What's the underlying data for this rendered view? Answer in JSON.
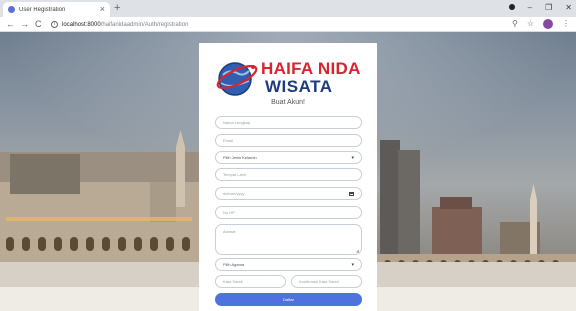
{
  "browser": {
    "tab_title": "User Registration",
    "tab_close": "×",
    "new_tab": "+",
    "url_host": "localhost:8000",
    "url_path": "/haifanidaadmin/Auth/registration",
    "back": "←",
    "forward": "→",
    "reload": "C",
    "info": "i",
    "zoom": "⚲",
    "star": "☆",
    "profile_initial": "N",
    "menu": "⋮",
    "minimize": "–",
    "maximize": "❐",
    "close": "✕"
  },
  "logo": {
    "line1": "HAIFA NIDA",
    "line2": "WISATA"
  },
  "form": {
    "subtitle": "Buat Akun!",
    "nama_placeholder": "Nama Lengkap",
    "email_placeholder": "Email",
    "jenis_kelamin": "Pilih Jenis Kelamin",
    "tempat_lahir_placeholder": "Tempat Lahir",
    "tanggal_lahir": "dd/mm/yyyy",
    "nohp_placeholder": "No HP",
    "alamat_placeholder": "Alamat",
    "agama": "Pilih Agama",
    "password_placeholder": "Kata Sandi",
    "confirm_placeholder": "Konfirmasi Kata Sandi",
    "submit_label": "Daftar"
  },
  "colors": {
    "brand_red": "#d9232e",
    "brand_navy": "#1d3c7a",
    "button_blue": "#4e73df"
  },
  "icons": [
    "globe-logo-icon",
    "calendar-icon",
    "chevron-down-icon",
    "info-icon",
    "star-icon",
    "zoom-icon"
  ]
}
